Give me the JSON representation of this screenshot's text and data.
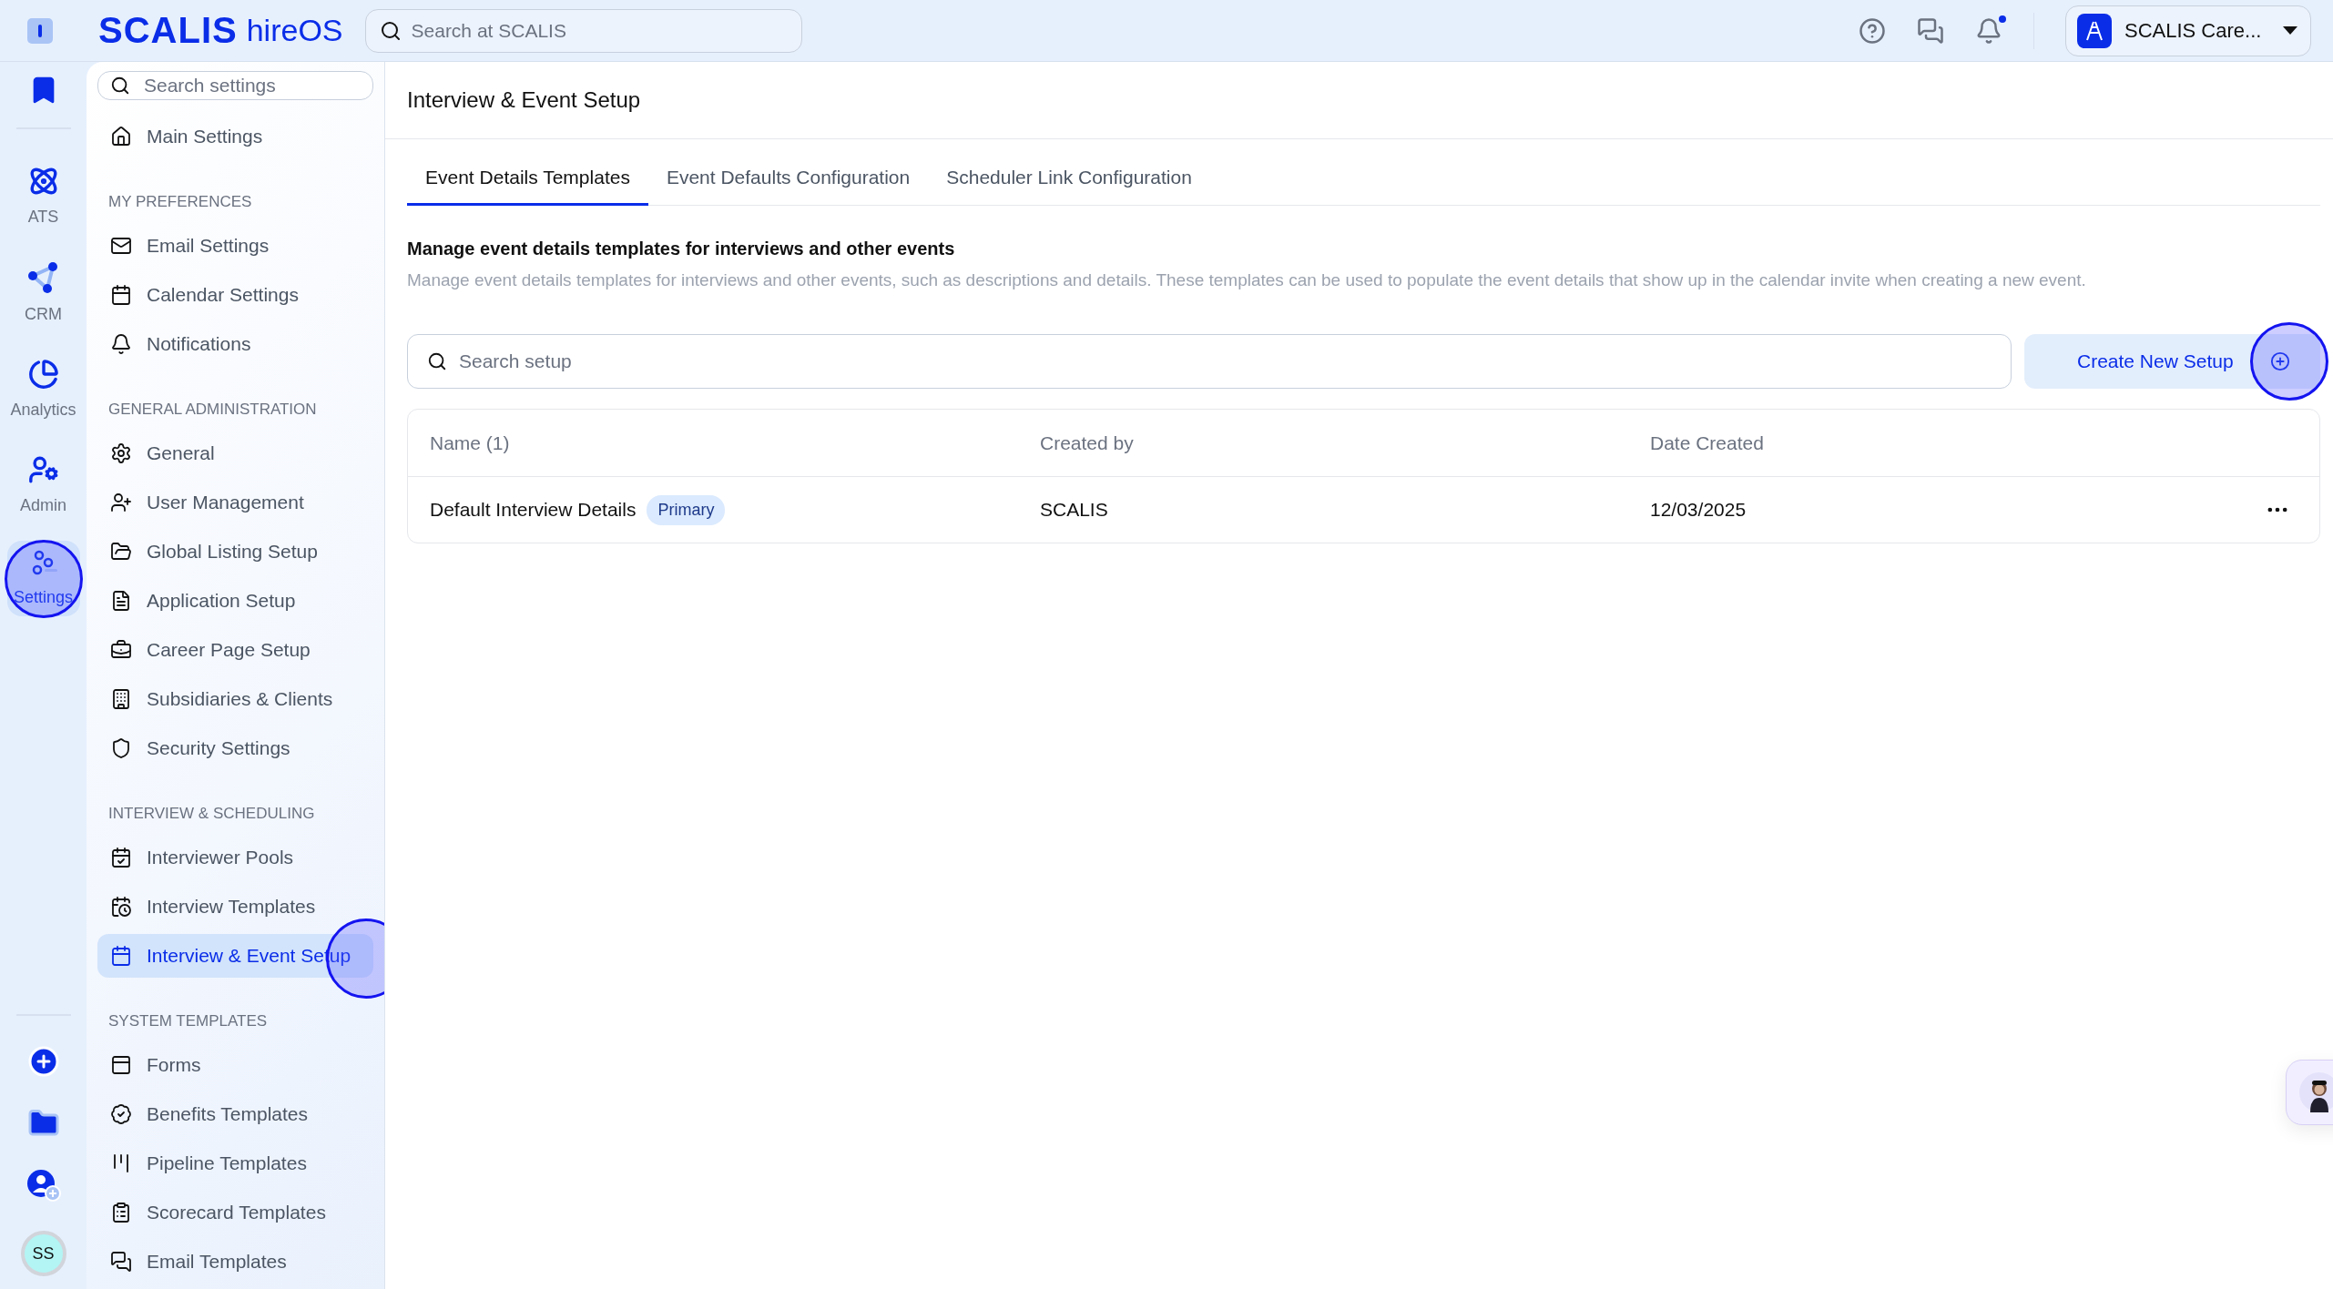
{
  "topbar": {
    "brand": "SCALIS",
    "product": "hireOS",
    "search": {
      "placeholder": "Search at SCALIS"
    },
    "notifications": {
      "unread": true
    },
    "account": {
      "name": "SCALIS Care..."
    }
  },
  "rail": {
    "items": [
      {
        "label": "ATS",
        "selected": false
      },
      {
        "label": "CRM",
        "selected": false
      },
      {
        "label": "Analytics",
        "selected": false
      },
      {
        "label": "Admin",
        "selected": false
      },
      {
        "label": "Settings",
        "selected": true
      }
    ],
    "avatar": "SS"
  },
  "sidebar": {
    "search": {
      "placeholder": "Search settings"
    },
    "main_item": {
      "label": "Main Settings",
      "selected": false
    },
    "sections": [
      {
        "heading": "MY PREFERENCES",
        "items": [
          {
            "label": "Email Settings",
            "selected": false
          },
          {
            "label": "Calendar Settings",
            "selected": false
          },
          {
            "label": "Notifications",
            "selected": false
          }
        ]
      },
      {
        "heading": "GENERAL ADMINISTRATION",
        "items": [
          {
            "label": "General",
            "selected": false
          },
          {
            "label": "User Management",
            "selected": false
          },
          {
            "label": "Global Listing Setup",
            "selected": false
          },
          {
            "label": "Application Setup",
            "selected": false
          },
          {
            "label": "Career Page Setup",
            "selected": false
          },
          {
            "label": "Subsidiaries & Clients",
            "selected": false
          },
          {
            "label": "Security Settings",
            "selected": false
          }
        ]
      },
      {
        "heading": "INTERVIEW & SCHEDULING",
        "items": [
          {
            "label": "Interviewer Pools",
            "selected": false
          },
          {
            "label": "Interview Templates",
            "selected": false
          },
          {
            "label": "Interview & Event Setup",
            "selected": true
          }
        ]
      },
      {
        "heading": "SYSTEM TEMPLATES",
        "items": [
          {
            "label": "Forms",
            "selected": false
          },
          {
            "label": "Benefits Templates",
            "selected": false
          },
          {
            "label": "Pipeline Templates",
            "selected": false
          },
          {
            "label": "Scorecard Templates",
            "selected": false
          },
          {
            "label": "Email Templates",
            "selected": false
          }
        ]
      }
    ]
  },
  "main": {
    "title": "Interview & Event Setup",
    "tabs": [
      {
        "label": "Event Details Templates",
        "selected": true
      },
      {
        "label": "Event Defaults Configuration",
        "selected": false
      },
      {
        "label": "Scheduler Link Configuration",
        "selected": false
      }
    ],
    "heading": "Manage event details templates for interviews and other events",
    "description": "Manage event details templates for interviews and other events, such as descriptions and details. These templates can be used to populate the event details that show up in the calendar invite when creating a new event.",
    "search": {
      "placeholder": "Search setup"
    },
    "create_button": "Create New Setup",
    "table": {
      "columns": [
        "Name (1)",
        "Created by",
        "Date Created"
      ],
      "rows": [
        {
          "name": "Default Interview Details",
          "badge": "Primary",
          "created_by": "SCALIS",
          "date_created": "12/03/2025"
        }
      ]
    }
  }
}
